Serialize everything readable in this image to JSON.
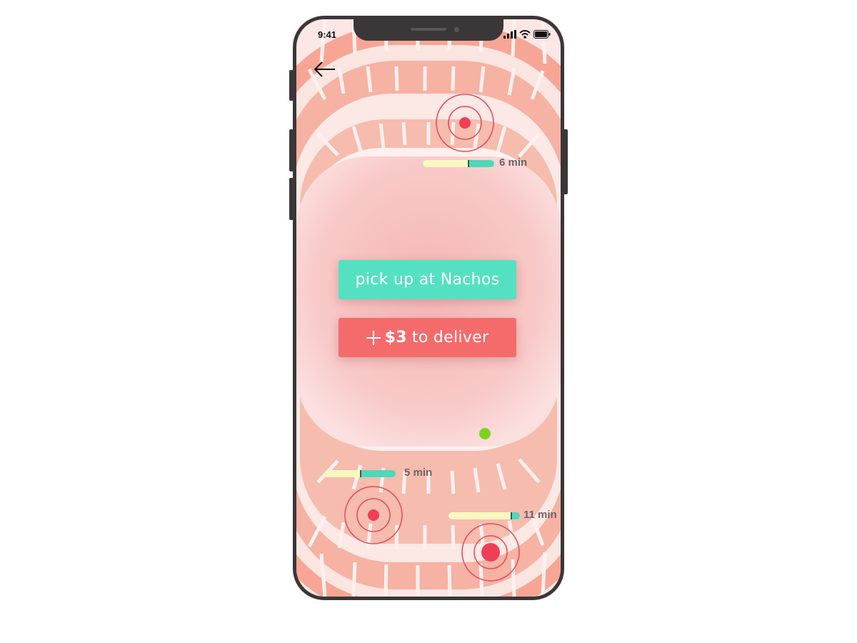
{
  "status_bar": {
    "time": "9:41"
  },
  "header": {
    "back_icon": "arrow-left-icon"
  },
  "actions": {
    "pickup_label": "pick up at Nachos",
    "deliver_prefix_icon": "plus-icon",
    "deliver_amount": "$3",
    "deliver_suffix": "to deliver"
  },
  "map": {
    "locations": [
      {
        "eta": "6 min",
        "progress": 0.63
      },
      {
        "eta": "5 min",
        "progress": 0.5
      },
      {
        "eta": "11 min",
        "progress": 0.87
      }
    ],
    "user_marker": "current-location-dot"
  },
  "colors": {
    "pickup": "#54e1c2",
    "deliver": "#f56b6c",
    "pin": "#f03e55",
    "user_dot": "#7ed321",
    "progress_fill": "#f9f8c1",
    "progress_track": "#4fd8b8"
  }
}
